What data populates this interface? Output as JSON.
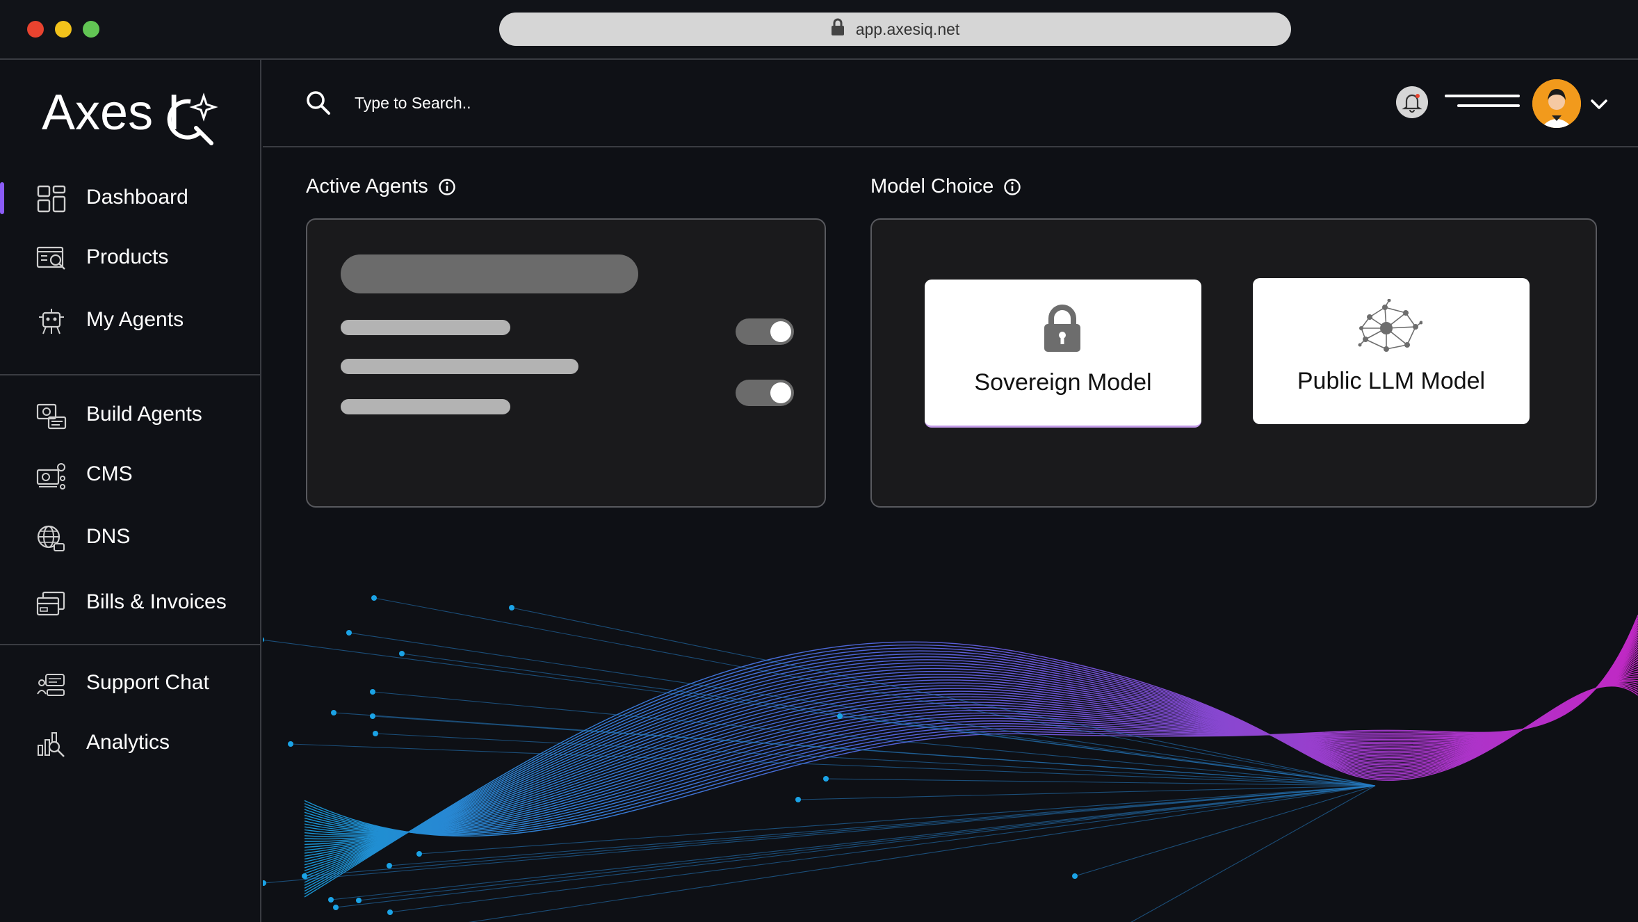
{
  "browser": {
    "url": "app.axesiq.net",
    "dots": {
      "close": "#e8432f",
      "minimize": "#f2c21b",
      "maximize": "#62c554"
    }
  },
  "brand": {
    "logo_text": "Axes IQ"
  },
  "sidebar": {
    "items": [
      {
        "label": "Dashboard",
        "icon": "dashboard-icon",
        "active": true
      },
      {
        "label": "Products",
        "icon": "products-icon"
      },
      {
        "label": "My Agents",
        "icon": "robot-icon"
      },
      {
        "label": "Build Agents",
        "icon": "build-agents-icon"
      },
      {
        "label": "CMS",
        "icon": "cms-icon"
      },
      {
        "label": "DNS",
        "icon": "globe-icon"
      },
      {
        "label": "Bills & Invoices",
        "icon": "invoice-icon"
      },
      {
        "label": "Support Chat",
        "icon": "support-chat-icon"
      },
      {
        "label": "Analytics",
        "icon": "analytics-icon"
      }
    ],
    "accent_color": "#8b5cf6"
  },
  "header": {
    "search": {
      "placeholder": "Type to Search.."
    },
    "notification_icon": "bell-icon",
    "menu_icon": "menu-lines-icon",
    "profile_icon": "avatar"
  },
  "active_agents": {
    "title": "Active Agents",
    "toggles": [
      {
        "on": true
      },
      {
        "on": true
      }
    ]
  },
  "model_choice": {
    "title": "Model Choice",
    "options": [
      {
        "label": "Sovereign Model",
        "icon": "lock-icon"
      },
      {
        "label": "Public LLM Model",
        "icon": "network-icon"
      }
    ]
  },
  "decoration": {
    "wave_colors": [
      "#1ba3e6",
      "#5b6cf0",
      "#b23fe0",
      "#d52bd8"
    ]
  }
}
